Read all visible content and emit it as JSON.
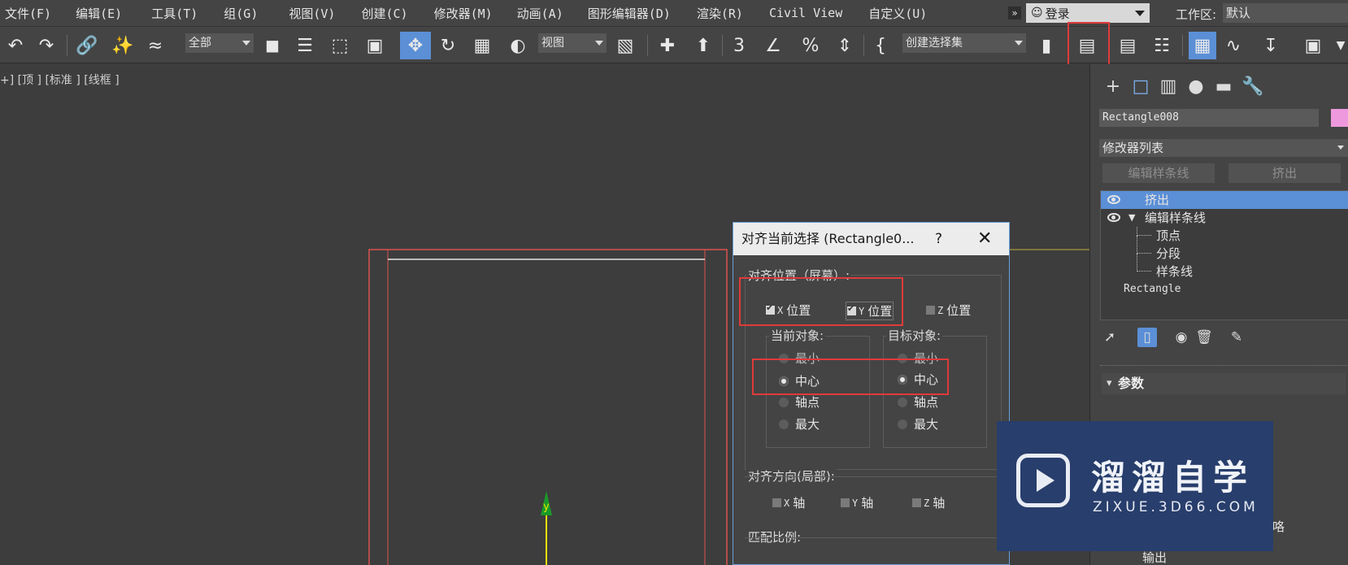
{
  "menubar": {
    "items": [
      "文件(F)",
      "编辑(E)",
      "工具(T)",
      "组(G)",
      "视图(V)",
      "创建(C)",
      "修改器(M)",
      "动画(A)",
      "图形编辑器(D)",
      "渲染(R)",
      "Civil View",
      "自定义(U)"
    ],
    "more": "»",
    "login": "登录",
    "workspace_label": "工作区:",
    "workspace_value": "默认"
  },
  "toolbar": {
    "selection_filter": "全部",
    "coord_system": "视图",
    "named_selection": "创建选择集"
  },
  "viewport": {
    "label": "+] [顶 ] [标准 ] [线框 ]",
    "axis_y": "y"
  },
  "panel": {
    "object_name": "Rectangle008",
    "object_color": "#ee99dd",
    "modifier_list": "修改器列表",
    "btn_edit_spline": "编辑样条线",
    "btn_extrude": "挤出",
    "stack": {
      "extrude": "挤出",
      "edit_spline": "编辑样条线",
      "vertex": "顶点",
      "segment": "分段",
      "spline": "样条线",
      "rectangle": "Rectangle"
    },
    "rollout_params": "参数",
    "frag_lu": "咯",
    "frag_output": "输出"
  },
  "dialog": {
    "title": "对齐当前选择 (Rectangle0...",
    "help": "?",
    "close": "✕",
    "align_position_label": "对齐位置（屏幕）:",
    "x_pos": {
      "prefix": "X",
      "label": "位置",
      "checked": true
    },
    "y_pos": {
      "prefix": "Y",
      "label": "位置",
      "checked": true
    },
    "z_pos": {
      "prefix": "Z",
      "label": "位置",
      "checked": false
    },
    "current_object_label": "当前对象:",
    "target_object_label": "目标对象:",
    "options": {
      "min": "最小",
      "center": "中心",
      "pivot": "轴点",
      "max": "最大"
    },
    "current_selected": "中心",
    "target_selected": "中心",
    "align_orientation_label": "对齐方向(局部):",
    "x_axis": {
      "prefix": "X",
      "label": "轴"
    },
    "y_axis": {
      "prefix": "Y",
      "label": "轴"
    },
    "z_axis": {
      "prefix": "Z",
      "label": "轴"
    },
    "match_scale_label": "匹配比例:"
  },
  "watermark": {
    "title": "溜溜自学",
    "subtitle": "ZIXUE.3D66.COM"
  },
  "colors": {
    "highlight": "#e03a3a",
    "accent": "#5b8fd6",
    "dialog_border": "#6a9fdc"
  }
}
